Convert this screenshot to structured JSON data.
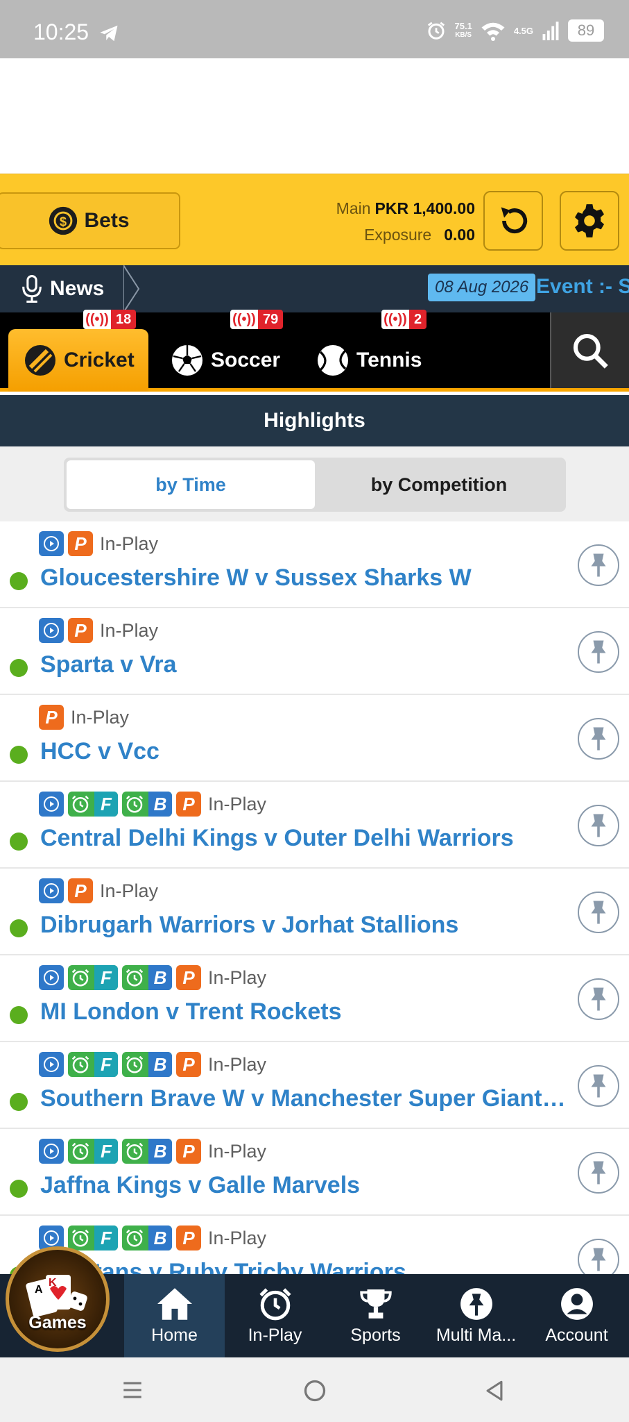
{
  "status_bar": {
    "time": "10:25",
    "speed_value": "75.1",
    "speed_unit": "KB/S",
    "network": "4.5G",
    "battery": "89"
  },
  "account": {
    "bets_label": "Bets",
    "main_label": "Main",
    "main_value": "PKR 1,400.00",
    "exposure_label": "Exposure",
    "exposure_value": "0.00"
  },
  "news": {
    "label": "News",
    "date": "08 Aug 2026",
    "event_text": "Event :- S"
  },
  "sports": [
    {
      "label": "Cricket",
      "count": "18",
      "icon": "cricket-bat-icon",
      "active": true
    },
    {
      "label": "Soccer",
      "count": "79",
      "icon": "soccer-ball-icon",
      "active": false
    },
    {
      "label": "Tennis",
      "count": "2",
      "icon": "tennis-ball-icon",
      "active": false
    }
  ],
  "highlights": {
    "title": "Highlights",
    "filters": [
      "by Time",
      "by Competition"
    ],
    "active_filter": "by Time"
  },
  "matches": [
    {
      "name": "Gloucestershire W v Sussex Sharks W",
      "status": "In-Play",
      "icons": [
        "play",
        "p"
      ]
    },
    {
      "name": "Sparta v Vra",
      "status": "In-Play",
      "icons": [
        "play",
        "p"
      ]
    },
    {
      "name": "HCC v Vcc",
      "status": "In-Play",
      "icons": [
        "p"
      ]
    },
    {
      "name": "Central Delhi Kings v Outer Delhi Warriors",
      "status": "In-Play",
      "icons": [
        "play",
        "fancy",
        "book",
        "p"
      ]
    },
    {
      "name": "Dibrugarh Warriors v Jorhat Stallions",
      "status": "In-Play",
      "icons": [
        "play",
        "p"
      ]
    },
    {
      "name": "MI London v Trent Rockets",
      "status": "In-Play",
      "icons": [
        "play",
        "fancy",
        "book",
        "p"
      ]
    },
    {
      "name": "Southern Brave W v Manchester Super Giant…",
      "status": "In-Play",
      "icons": [
        "play",
        "fancy",
        "book",
        "p"
      ]
    },
    {
      "name": "Jaffna Kings v Galle Marvels",
      "status": "In-Play",
      "icons": [
        "play",
        "fancy",
        "book",
        "p"
      ]
    },
    {
      "name": "Sportans v Ruby Trichy Warriors",
      "status": "In-Play",
      "icons": [
        "play",
        "fancy",
        "book",
        "p"
      ]
    }
  ],
  "bottom_nav": {
    "games": "Games",
    "items": [
      {
        "label": "Home",
        "icon": "home-icon",
        "active": true
      },
      {
        "label": "In-Play",
        "icon": "alarm-clock-icon",
        "active": false
      },
      {
        "label": "Sports",
        "icon": "trophy-icon",
        "active": false
      },
      {
        "label": "Multi Ma...",
        "icon": "pin-icon",
        "active": false
      },
      {
        "label": "Account",
        "icon": "user-icon",
        "active": false
      }
    ]
  },
  "colors": {
    "accent_yellow": "#fdc829",
    "dark_navy": "#223141",
    "link_blue": "#2f82c8",
    "live_green": "#5aae1e",
    "badge_red": "#e0232b"
  }
}
